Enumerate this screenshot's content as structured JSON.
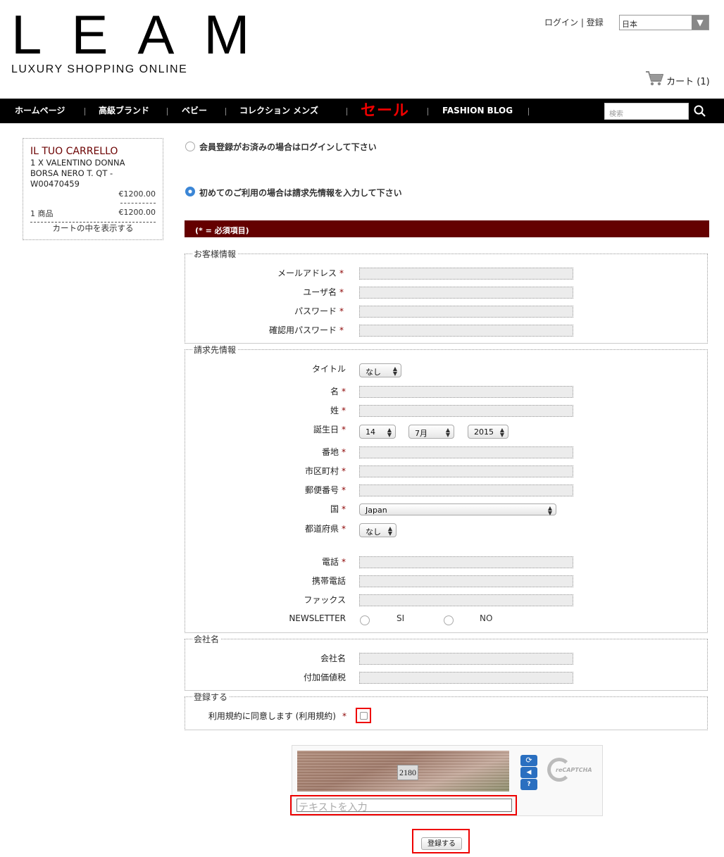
{
  "header": {
    "logo": "LEAM",
    "tagline": "LUXURY SHOPPING ONLINE",
    "login": "ログイン",
    "separator": "|",
    "register": "登録",
    "language": "日本",
    "cart_label": "カート",
    "cart_count": "(1)"
  },
  "nav": {
    "items": [
      "ホームページ",
      "高級ブランド",
      "ベビー",
      "コレクション メンズ",
      "セール",
      "FASHION BLOG"
    ],
    "search_placeholder": "検索"
  },
  "sidebar": {
    "title": "IL TUO CARRELLO",
    "item_line1": "1 X VALENTINO DONNA",
    "item_line2": "BORSA NERO T. QT -",
    "item_line3": "W00470459",
    "item_price": "€1200.00",
    "count": "1 商品",
    "total": "€1200.00",
    "view_cart": "カートの中を表示する"
  },
  "options": {
    "login": "会員登録がお済みの場合はログインして下さい",
    "new": "初めてのご利用の場合は請求先情報を入力して下さい"
  },
  "required_bar": "(* = 必須項目)",
  "customer": {
    "legend": "お客様情報",
    "email": "メールアドレス",
    "username": "ユーザ名",
    "password": "パスワード",
    "confirm": "確認用パスワード"
  },
  "billing": {
    "legend": "請求先情報",
    "title": "タイトル",
    "title_value": "なし",
    "first_name": "名",
    "last_name": "姓",
    "birthday": "誕生日",
    "day": "14",
    "month": "7月",
    "year": "2015",
    "address": "番地",
    "city": "市区町村",
    "zip": "郵便番号",
    "country": "国",
    "country_value": "Japan",
    "prefecture": "都道府県",
    "prefecture_value": "なし",
    "phone": "電話",
    "mobile": "携帯電話",
    "fax": "ファックス",
    "newsletter": "NEWSLETTER",
    "yes": "SI",
    "no": "NO"
  },
  "company": {
    "legend": "会社名",
    "name": "会社名",
    "vat": "付加価値税"
  },
  "register": {
    "legend": "登録する",
    "terms": "利用規約に同意します (利用規約)"
  },
  "captcha": {
    "number": "2180",
    "placeholder": "テキストを入力",
    "brand": "reCAPTCHA"
  },
  "submit": "登録する",
  "required_mark": "*"
}
